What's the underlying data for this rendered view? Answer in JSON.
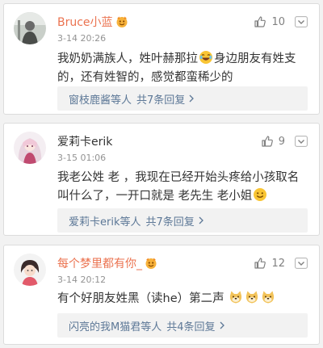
{
  "comments": [
    {
      "username": "Bruce小蓝",
      "time": "3-14 20:26",
      "likes": "10",
      "text_part1": "我奶奶满族人，姓叶赫那拉",
      "text_part2": "身边朋友有姓支的，还有姓智的，感觉都蛮稀少的",
      "reply_users": "窗枝鹿酱等人",
      "reply_count": "共7条回复"
    },
    {
      "username": "爱莉卡erik",
      "time": "3-15 01:06",
      "likes": "9",
      "text_part1": "我老公姓 老 ，我现在已经开始头疼给小孩取名叫什么了，一开口就是 老先生  老小姐",
      "reply_users": "爱莉卡erik等人",
      "reply_count": "共7条回复"
    },
    {
      "username": "每个梦里都有你_",
      "time": "3-14 20:12",
      "likes": "12",
      "text_part1": "有个好朋友姓黑（读he）第二声",
      "reply_users": "闪亮的我M猫君等人",
      "reply_count": "共4条回复"
    }
  ],
  "icons": {
    "like": "thumbs-up-icon",
    "more": "chevron-down-icon",
    "reply_arrow": "chevron-right-icon",
    "badge": "fan-badge-icon"
  },
  "colors": {
    "username_highlight": "#eb7350",
    "link": "#5d7897",
    "muted": "#808080"
  }
}
